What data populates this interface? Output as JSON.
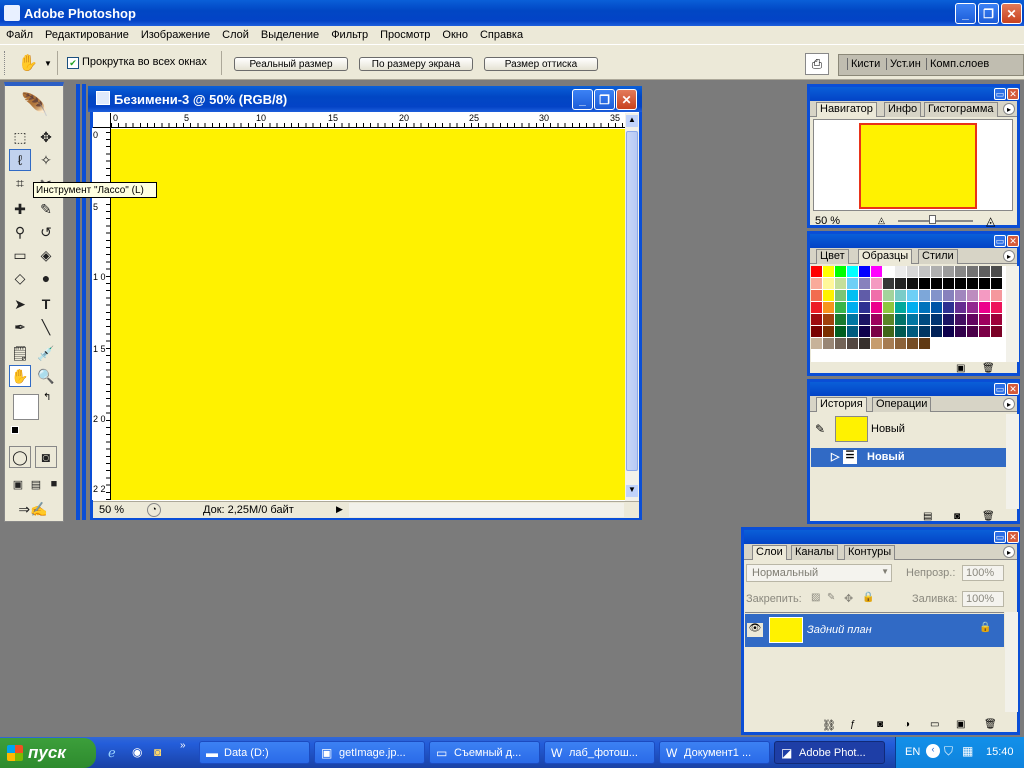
{
  "app": {
    "title": "Adobe Photoshop"
  },
  "menu": [
    "Файл",
    "Редактирование",
    "Изображение",
    "Слой",
    "Выделение",
    "Фильтр",
    "Просмотр",
    "Окно",
    "Справка"
  ],
  "options": {
    "scroll_all_label": "Прокрутка во всех окнах",
    "btn_actual": "Реальный размер",
    "btn_fit": "По размеру экрана",
    "btn_print": "Размер оттиска",
    "well_tabs": [
      "Кисти",
      "Уст.ин",
      "Комп.слоев"
    ]
  },
  "tooltip": "Инструмент \"Лассо\" (L)",
  "document": {
    "title": "Безимени-3 @ 50% (RGB/8)",
    "zoom": "50 %",
    "doc_size": "Док: 2,25M/0 байт",
    "canvas_color": "#fff200",
    "ruler_h": [
      "0",
      "5",
      "10",
      "15",
      "20",
      "25",
      "30",
      "35"
    ],
    "ruler_v": [
      "0",
      "5",
      "1 0",
      "1 5",
      "2 0",
      "2 2"
    ]
  },
  "navigator": {
    "tabs": [
      "Навигатор",
      "Инфо",
      "Гистограмма"
    ],
    "zoom": "50 %"
  },
  "swatches": {
    "tabs": [
      "Цвет",
      "Образцы",
      "Стили"
    ]
  },
  "history": {
    "tabs": [
      "История",
      "Операции"
    ],
    "snapshot_label": "Новый",
    "state_label": "Новый"
  },
  "layers": {
    "tabs": [
      "Слои",
      "Каналы",
      "Контуры"
    ],
    "blend_mode": "Нормальный",
    "opacity_label": "Непрозр.:",
    "opacity_value": "100%",
    "lock_label": "Закрепить:",
    "fill_label": "Заливка:",
    "fill_value": "100%",
    "layer_name": "Задний план"
  },
  "taskbar": {
    "start": "пуск",
    "tasks": [
      "Data (D:)",
      "getImage.jp...",
      "Съемный д...",
      "лаб_фотош...",
      "Документ1 ...",
      "Adobe Phot..."
    ],
    "lang": "EN",
    "clock": "15:40"
  },
  "colors": {
    "accent": "#0a4ed6",
    "foreground": "#ffffff",
    "background": "#fff200"
  }
}
